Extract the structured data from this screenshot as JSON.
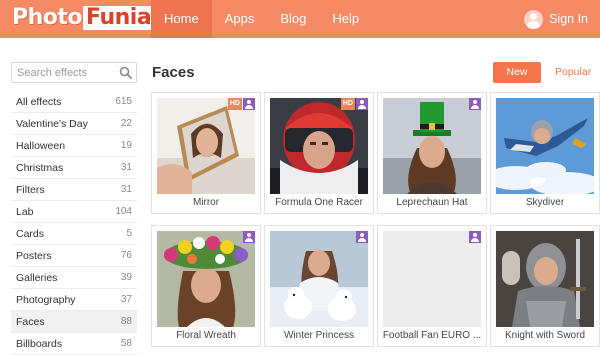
{
  "brand": {
    "part1": "Photo",
    "part2": "Funia"
  },
  "nav": [
    {
      "label": "Home",
      "active": true
    },
    {
      "label": "Apps",
      "active": false
    },
    {
      "label": "Blog",
      "active": false
    },
    {
      "label": "Help",
      "active": false
    }
  ],
  "header": {
    "signin_label": "Sign In"
  },
  "search": {
    "placeholder": "Search effects"
  },
  "sidebar": {
    "items": [
      {
        "label": "All effects",
        "count": "615"
      },
      {
        "label": "Valentine's Day",
        "count": "22"
      },
      {
        "label": "Halloween",
        "count": "19"
      },
      {
        "label": "Christmas",
        "count": "31"
      },
      {
        "label": "Filters",
        "count": "31"
      },
      {
        "label": "Lab",
        "count": "104"
      },
      {
        "label": "Cards",
        "count": "5"
      },
      {
        "label": "Posters",
        "count": "76"
      },
      {
        "label": "Galleries",
        "count": "39"
      },
      {
        "label": "Photography",
        "count": "37"
      },
      {
        "label": "Faces",
        "count": "88"
      },
      {
        "label": "Billboards",
        "count": "58"
      }
    ]
  },
  "main": {
    "title": "Faces",
    "sort_new": "New",
    "sort_popular": "Popular",
    "badge_hd": "HD",
    "cards": [
      {
        "caption": "Mirror",
        "hd": true
      },
      {
        "caption": "Formula One Racer",
        "hd": true
      },
      {
        "caption": "Leprechaun Hat",
        "hd": false
      },
      {
        "caption": "Skydiver",
        "hd": false
      },
      {
        "caption": "Floral Wreath",
        "hd": false
      },
      {
        "caption": "Winter Princess",
        "hd": false
      },
      {
        "caption": "Football Fan EURO ...",
        "hd": false
      },
      {
        "caption": "Knight with Sword",
        "hd": false
      }
    ]
  },
  "colors": {
    "header": "#f58a65",
    "accent": "#f4754c",
    "badge_user": "#8b5cb8",
    "badge_hd": "#e8885a"
  }
}
